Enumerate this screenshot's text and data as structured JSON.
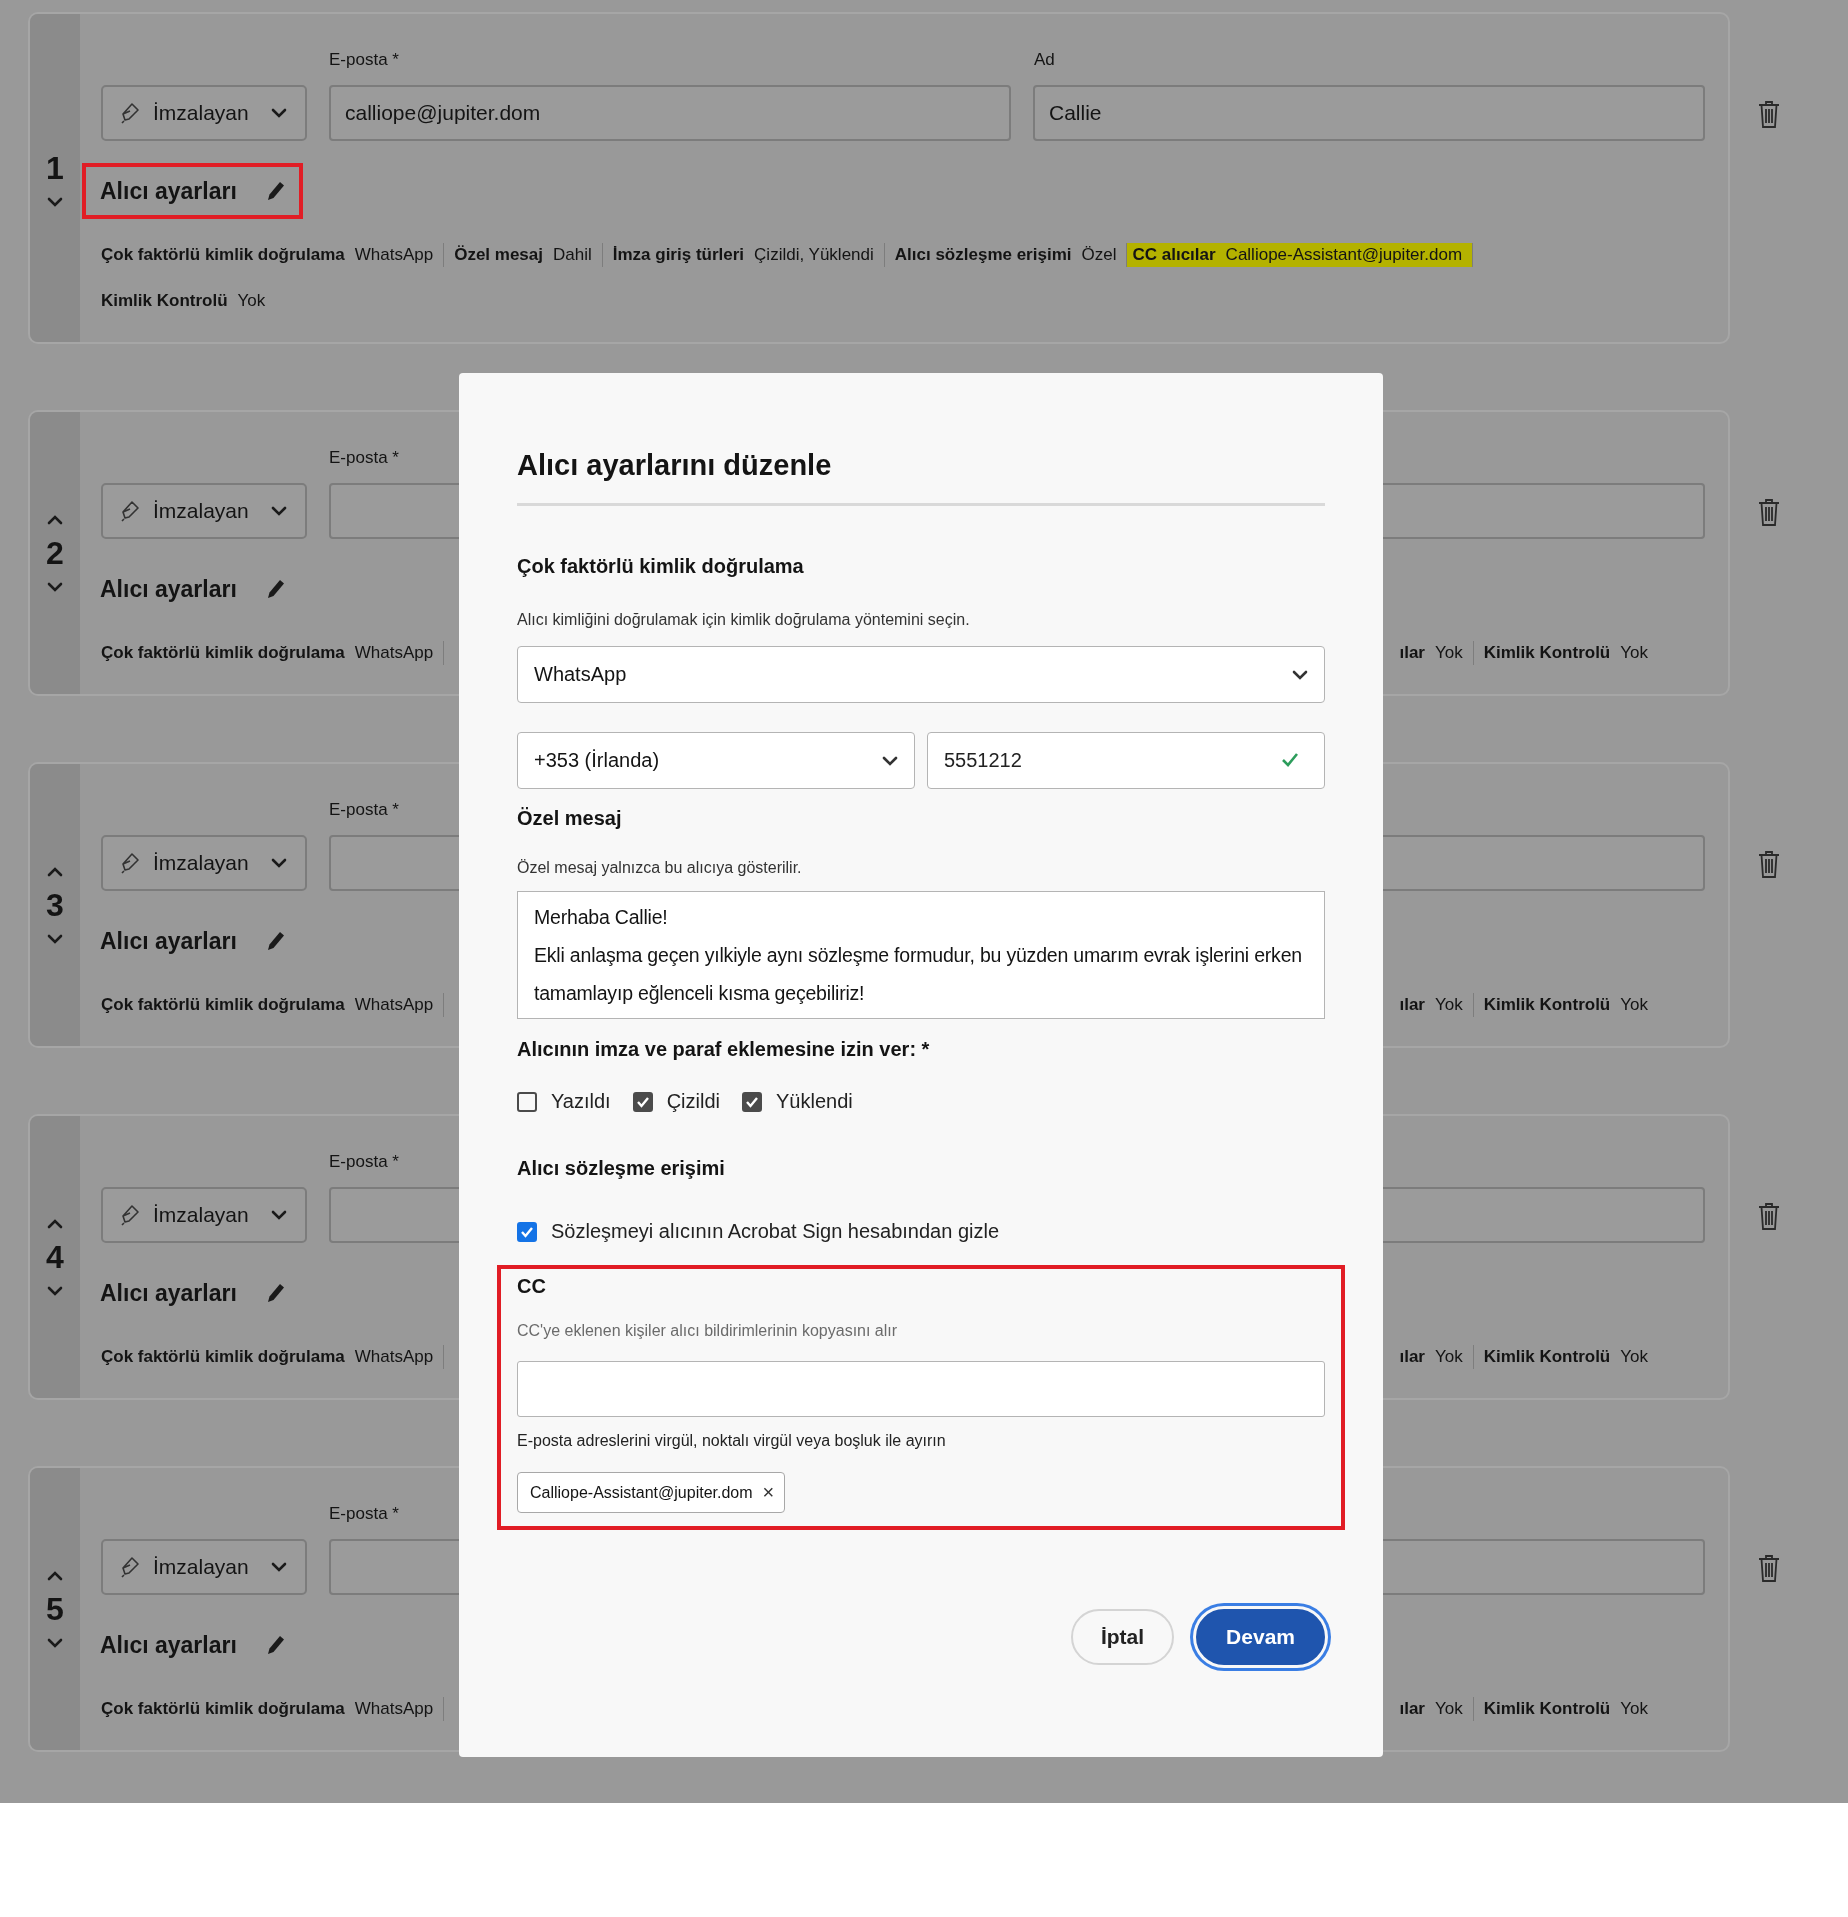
{
  "recipients": [
    {
      "number": "1",
      "can_move_up": false,
      "can_move_down": true,
      "role": "İmzalayan",
      "email_label": "E-posta *",
      "email": "calliope@jupiter.dom",
      "name_label": "Ad",
      "name": "Callie",
      "settings_label": "Alıcı ayarları",
      "annotated": true,
      "summary_lines": [
        [
          {
            "label": "Çok faktörlü kimlik doğrulama",
            "value": "WhatsApp",
            "highlighted": false
          },
          {
            "label": "Özel mesaj",
            "value": "Dahil",
            "highlighted": false
          },
          {
            "label": "İmza giriş türleri",
            "value": "Çizildi, Yüklendi",
            "highlighted": false
          },
          {
            "label": "Alıcı sözleşme erişimi",
            "value": "Özel",
            "highlighted": false
          },
          {
            "label": "CC alıcılar",
            "value": "Calliope-Assistant@jupiter.dom",
            "highlighted": true
          }
        ],
        [
          {
            "label": "Kimlik Kontrolü",
            "value": "Yok",
            "highlighted": false
          }
        ]
      ]
    },
    {
      "number": "2",
      "can_move_up": true,
      "can_move_down": true,
      "role": "İmzalayan",
      "email_label": "E-posta *",
      "settings_label": "Alıcı ayarları",
      "annotated": false,
      "summary_lines": [
        [
          {
            "label": "Çok faktörlü kimlik doğrulama",
            "value": "WhatsApp",
            "highlighted": false
          }
        ]
      ],
      "summary_tail": [
        {
          "label": "ılar",
          "value": "Yok",
          "highlighted": false
        },
        {
          "label": "Kimlik Kontrolü",
          "value": "Yok",
          "highlighted": false
        }
      ]
    },
    {
      "number": "3",
      "can_move_up": true,
      "can_move_down": true,
      "role": "İmzalayan",
      "email_label": "E-posta *",
      "settings_label": "Alıcı ayarları",
      "annotated": false,
      "summary_lines": [
        [
          {
            "label": "Çok faktörlü kimlik doğrulama",
            "value": "WhatsApp",
            "highlighted": false
          }
        ]
      ],
      "summary_tail": [
        {
          "label": "ılar",
          "value": "Yok",
          "highlighted": false
        },
        {
          "label": "Kimlik Kontrolü",
          "value": "Yok",
          "highlighted": false
        }
      ]
    },
    {
      "number": "4",
      "can_move_up": true,
      "can_move_down": true,
      "role": "İmzalayan",
      "email_label": "E-posta *",
      "settings_label": "Alıcı ayarları",
      "annotated": false,
      "summary_lines": [
        [
          {
            "label": "Çok faktörlü kimlik doğrulama",
            "value": "WhatsApp",
            "highlighted": false
          }
        ]
      ],
      "summary_tail": [
        {
          "label": "ılar",
          "value": "Yok",
          "highlighted": false
        },
        {
          "label": "Kimlik Kontrolü",
          "value": "Yok",
          "highlighted": false
        }
      ]
    },
    {
      "number": "5",
      "can_move_up": true,
      "can_move_down": true,
      "role": "İmzalayan",
      "email_label": "E-posta *",
      "settings_label": "Alıcı ayarları",
      "annotated": false,
      "summary_lines": [
        [
          {
            "label": "Çok faktörlü kimlik doğrulama",
            "value": "WhatsApp",
            "highlighted": false
          }
        ]
      ],
      "summary_tail": [
        {
          "label": "ılar",
          "value": "Yok",
          "highlighted": false
        },
        {
          "label": "Kimlik Kontrolü",
          "value": "Yok",
          "highlighted": false
        }
      ]
    }
  ],
  "dialog": {
    "title": "Alıcı ayarlarını düzenle",
    "mfa": {
      "heading": "Çok faktörlü kimlik doğrulama",
      "description": "Alıcı kimliğini doğrulamak için kimlik doğrulama yöntemini seçin.",
      "method": "WhatsApp",
      "country": "+353 (İrlanda)",
      "phone": "5551212",
      "phone_valid": true
    },
    "message": {
      "heading": "Özel mesaj",
      "description": "Özel mesaj yalnızca bu alıcıya gösterilir.",
      "value": "Merhaba Callie!\nEkli anlaşma geçen yılkiyle aynı sözleşme formudur, bu yüzden umarım evrak işlerini erken tamamlayıp eğlenceli kısma geçebiliriz!"
    },
    "signature_types": {
      "heading": "Alıcının imza ve paraf eklemesine izin ver: *",
      "options": [
        {
          "label": "Yazıldı",
          "checked": false
        },
        {
          "label": "Çizildi",
          "checked": true
        },
        {
          "label": "Yüklendi",
          "checked": true
        }
      ]
    },
    "access": {
      "heading": "Alıcı sözleşme erişimi",
      "options": [
        {
          "label": "Sözleşmeyi alıcının Acrobat Sign hesabından gizle",
          "checked": true
        }
      ]
    },
    "cc": {
      "heading": "CC",
      "description": "CC'ye eklenen kişiler alıcı bildirimlerinin kopyasını alır",
      "hint": "E-posta adreslerini virgül, noktalı virgül veya boşluk ile ayırın",
      "annotated": true,
      "chips": [
        {
          "label": "Calliope-Assistant@jupiter.dom",
          "remove": "×"
        }
      ]
    },
    "buttons": [
      {
        "label": "İptal",
        "kind": "secondary",
        "focused": false
      },
      {
        "label": "Devam",
        "kind": "primary",
        "focused": true
      }
    ]
  }
}
